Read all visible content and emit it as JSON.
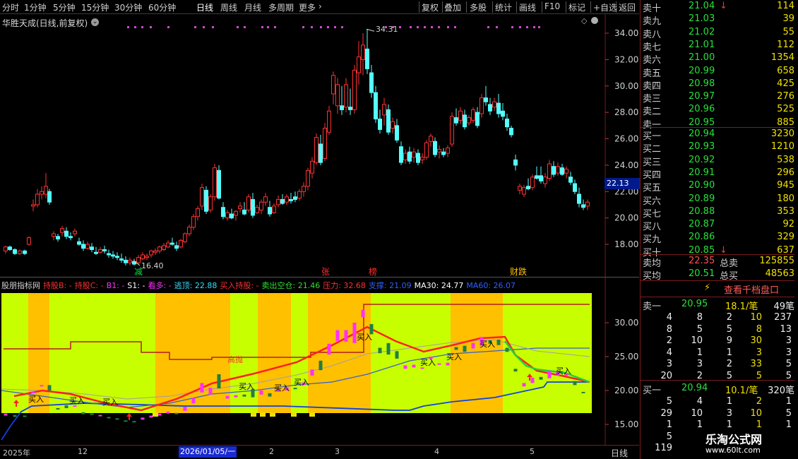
{
  "toolbar": {
    "periods": [
      "分时",
      "1分钟",
      "5分钟",
      "15分钟",
      "30分钟",
      "60分钟",
      "日线",
      "周线",
      "月线",
      "多周期",
      "更多"
    ],
    "active_period": "日线",
    "more_arrow": "›",
    "actions": [
      "复权",
      "叠加",
      "多股",
      "统计",
      "画线",
      "F10",
      "标记",
      "+自选",
      "返回"
    ]
  },
  "main_chart": {
    "title": "华胜天成(日线,前复权)",
    "y_ticks": [
      "34.00",
      "32.00",
      "30.00",
      "28.00",
      "26.00",
      "24.00",
      "22.00",
      "20.00",
      "18.00"
    ],
    "current_price_tag": "22.13",
    "high_label": "34.31",
    "low_label": "16.40",
    "event_markers": [
      "减",
      "张",
      "榜",
      "财跌"
    ],
    "settings_icon": "diamond-icon"
  },
  "indicator": {
    "name": "股朋指标网",
    "legend": [
      {
        "label": "持股B: -",
        "color": "#ff3030"
      },
      {
        "label": "持股C: -",
        "color": "#ff3030"
      },
      {
        "label": "B1: -",
        "color": "#ff30ff"
      },
      {
        "label": "S1: -",
        "color": "#ffffff"
      },
      {
        "label": "看多: -",
        "color": "#ff30ff"
      },
      {
        "label": "逃顶: 22.88",
        "color": "#30e0ff"
      },
      {
        "label": "买入持股: -",
        "color": "#ff3030"
      },
      {
        "label": "卖出空仓: 21.46",
        "color": "#30e030"
      },
      {
        "label": "压力: 32.68",
        "color": "#ff3030"
      },
      {
        "label": "支撑: 21.09",
        "color": "#3060ff"
      },
      {
        "label": "MA30: 24.77",
        "color": "#ffffff"
      },
      {
        "label": "MA60: 26.07",
        "color": "#3060ff"
      }
    ],
    "y_ticks": [
      "30.00",
      "25.00",
      "20.00",
      "15.00"
    ],
    "texts": [
      "买入",
      "买入",
      "买入",
      "买入",
      "买入",
      "买入",
      "买入",
      "买入",
      "买入",
      "买入",
      "高抛",
      "买入"
    ]
  },
  "date_axis": {
    "labels": [
      "2025年",
      "12",
      "2",
      "3",
      "4",
      "5"
    ],
    "selected": "2026/01/05/一",
    "period": "日线"
  },
  "orderbook": {
    "asks": [
      {
        "label": "卖十",
        "price": "21.04",
        "arrow": "↓",
        "vol": "114"
      },
      {
        "label": "卖九",
        "price": "21.03",
        "vol": "39"
      },
      {
        "label": "卖八",
        "price": "21.02",
        "vol": "55"
      },
      {
        "label": "卖七",
        "price": "21.01",
        "vol": "112"
      },
      {
        "label": "卖六",
        "price": "21.00",
        "vol": "1354"
      },
      {
        "label": "卖五",
        "price": "20.99",
        "vol": "658"
      },
      {
        "label": "卖四",
        "price": "20.98",
        "vol": "425"
      },
      {
        "label": "卖三",
        "price": "20.97",
        "vol": "276"
      },
      {
        "label": "卖二",
        "price": "20.96",
        "vol": "525"
      },
      {
        "label": "卖一",
        "price": "20.95",
        "vol": "885"
      }
    ],
    "bids": [
      {
        "label": "买一",
        "price": "20.94",
        "vol": "3230"
      },
      {
        "label": "买二",
        "price": "20.93",
        "vol": "1210"
      },
      {
        "label": "买三",
        "price": "20.92",
        "vol": "538"
      },
      {
        "label": "买四",
        "price": "20.91",
        "vol": "296"
      },
      {
        "label": "买五",
        "price": "20.90",
        "vol": "945"
      },
      {
        "label": "买六",
        "price": "20.89",
        "vol": "180"
      },
      {
        "label": "买七",
        "price": "20.88",
        "vol": "353"
      },
      {
        "label": "买八",
        "price": "20.87",
        "vol": "92"
      },
      {
        "label": "买九",
        "price": "20.86",
        "vol": "329"
      },
      {
        "label": "买十",
        "price": "20.85",
        "arrow": "↓",
        "vol": "637"
      }
    ],
    "avg_sell": {
      "label": "卖均",
      "price": "22.35",
      "total_label": "总卖",
      "total": "125855"
    },
    "avg_buy": {
      "label": "买均",
      "price": "20.51",
      "total_label": "总买",
      "total": "48563"
    },
    "deep_button": "查看千档盘口",
    "queue_ask": {
      "label": "卖一",
      "price": "20.95",
      "per": "18.1/笔",
      "count": "49笔",
      "rows": [
        [
          "4",
          "8",
          "2",
          "10",
          "237"
        ],
        [
          "8",
          "5",
          "5",
          "8",
          "13"
        ],
        [
          "2",
          "10",
          "9",
          "30",
          "3"
        ],
        [
          "4",
          "1",
          "1",
          "3",
          "3"
        ],
        [
          "3",
          "3",
          "2",
          "33",
          "5"
        ],
        [
          "20",
          "2",
          "5",
          "5",
          "5"
        ]
      ]
    },
    "queue_bid": {
      "label": "买一",
      "price": "20.94",
      "per": "10.1/笔",
      "count": "320笔",
      "rows": [
        [
          "5",
          "4",
          "1",
          "2",
          "1"
        ],
        [
          "29",
          "10",
          "3",
          "10",
          "5"
        ],
        [
          "1",
          "1",
          "1",
          "1",
          "1"
        ],
        [
          "5",
          "",
          "",
          "",
          ""
        ],
        [
          "119",
          "",
          "",
          "",
          ""
        ]
      ]
    }
  },
  "watermark": {
    "title": "乐淘公式网",
    "url": "www.60lt.com"
  },
  "colors": {
    "up": "#ff3232",
    "down": "#54ffff",
    "ind_bg": "#c8ff00",
    "ind_band": "#ffc000",
    "ask_price": "#27e03a",
    "vol": "#f0e000"
  }
}
